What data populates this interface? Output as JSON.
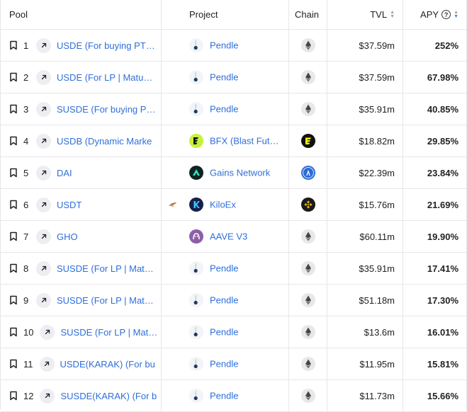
{
  "header": {
    "pool": "Pool",
    "project": "Project",
    "chain": "Chain",
    "tvl": "TVL",
    "apy": "APY",
    "help_symbol": "?"
  },
  "icons": {
    "bookmark": "bookmark-icon",
    "external_link": "arrow-up-right-icon",
    "help": "question-circle-icon",
    "sort": "sort-arrows-icon"
  },
  "colors": {
    "link": "#2f6fdb",
    "sort_active": "#3b82f6"
  },
  "rows": [
    {
      "rank": "1",
      "pool": "USDE (For buying PT…",
      "has_link": true,
      "project": "Pendle",
      "project_logo": "pendle",
      "chain_logo": "ethereum",
      "tvl": "$37.59m",
      "apy": "252%"
    },
    {
      "rank": "2",
      "pool": "USDE (For LP | Matu…",
      "has_link": true,
      "project": "Pendle",
      "project_logo": "pendle",
      "chain_logo": "ethereum",
      "tvl": "$37.59m",
      "apy": "67.98%"
    },
    {
      "rank": "3",
      "pool": "SUSDE (For buying P…",
      "has_link": true,
      "project": "Pendle",
      "project_logo": "pendle",
      "chain_logo": "ethereum",
      "tvl": "$35.91m",
      "apy": "40.85%"
    },
    {
      "rank": "4",
      "pool": "USDB (Dynamic Marke",
      "has_link": true,
      "project": "BFX (Blast Fut…",
      "project_logo": "bfx",
      "chain_logo": "blast",
      "tvl": "$18.82m",
      "apy": "29.85%"
    },
    {
      "rank": "5",
      "pool": "DAI",
      "has_link": true,
      "project": "Gains Network",
      "project_logo": "gains",
      "chain_logo": "arbitrum",
      "tvl": "$22.39m",
      "apy": "23.84%"
    },
    {
      "rank": "6",
      "pool": "USDT",
      "has_link": true,
      "project": "KiloEx",
      "project_logo": "kiloex",
      "chain_logo": "bsc",
      "tvl": "$15.76m",
      "apy": "21.69%",
      "extra_logo": "bird"
    },
    {
      "rank": "7",
      "pool": "GHO",
      "has_link": true,
      "project": "AAVE V3",
      "project_logo": "aave",
      "chain_logo": "ethereum",
      "tvl": "$60.11m",
      "apy": "19.90%"
    },
    {
      "rank": "8",
      "pool": "SUSDE (For LP | Mat…",
      "has_link": true,
      "project": "Pendle",
      "project_logo": "pendle",
      "chain_logo": "ethereum",
      "tvl": "$35.91m",
      "apy": "17.41%"
    },
    {
      "rank": "9",
      "pool": "SUSDE (For LP | Mat…",
      "has_link": true,
      "project": "Pendle",
      "project_logo": "pendle",
      "chain_logo": "ethereum",
      "tvl": "$51.18m",
      "apy": "17.30%"
    },
    {
      "rank": "10",
      "pool": "SUSDE (For LP | Mat…",
      "has_link": true,
      "project": "Pendle",
      "project_logo": "pendle",
      "chain_logo": "ethereum",
      "tvl": "$13.6m",
      "apy": "16.01%"
    },
    {
      "rank": "11",
      "pool": "USDE(KARAK) (For bu",
      "has_link": true,
      "project": "Pendle",
      "project_logo": "pendle",
      "chain_logo": "ethereum",
      "tvl": "$11.95m",
      "apy": "15.81%"
    },
    {
      "rank": "12",
      "pool": "SUSDE(KARAK) (For b",
      "has_link": true,
      "project": "Pendle",
      "project_logo": "pendle",
      "chain_logo": "ethereum",
      "tvl": "$11.73m",
      "apy": "15.66%"
    }
  ]
}
